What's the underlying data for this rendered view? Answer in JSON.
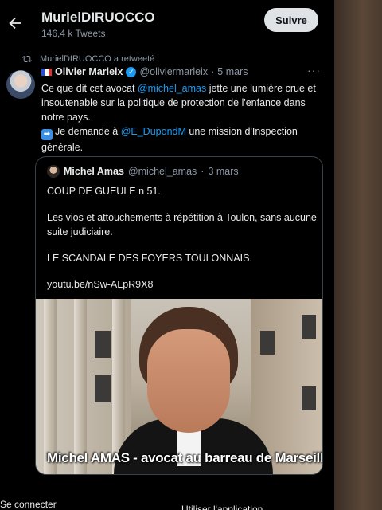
{
  "header": {
    "title": "MurielDIRUOCCO",
    "subtitle": "146,4 k Tweets",
    "follow_label": "Suivre"
  },
  "retweet": {
    "label": "MurielDIRUOCCO a retweeté"
  },
  "tweet": {
    "author_name": "Olivier Marleix",
    "author_handle": "@oliviermarleix",
    "date": "5 mars",
    "more": "···",
    "line1_pre": "Ce que dit cet avocat ",
    "line1_mention": "@michel_amas",
    "line1_post": " jette une lumière crue et insoutenable sur la politique de protection de l'enfance dans notre pays.",
    "line2_pre": "Je demande à ",
    "line2_mention": "@E_DupondM",
    "line2_post": " une mission d'Inspection générale."
  },
  "quote": {
    "author_name": "Michel Amas",
    "author_handle": "@michel_amas",
    "date": "3 mars",
    "p1": "COUP DE GUEULE n 51.",
    "p2": "Les vios et attouchements à répétition à Toulon, sans aucune suite judiciaire.",
    "p3": "LE SCANDALE DES FOYERS TOULONNAIS.",
    "link": "youtu.be/nSw-ALpR9X8",
    "video_caption": "Michel AMAS - avocat au barreau de Marseille"
  },
  "footer": {
    "login": "Se connecter",
    "use_app": "Utiliser l'application"
  },
  "colors": {
    "accent": "#1d9bf0",
    "background": "#000000",
    "muted": "#8b98a5"
  }
}
